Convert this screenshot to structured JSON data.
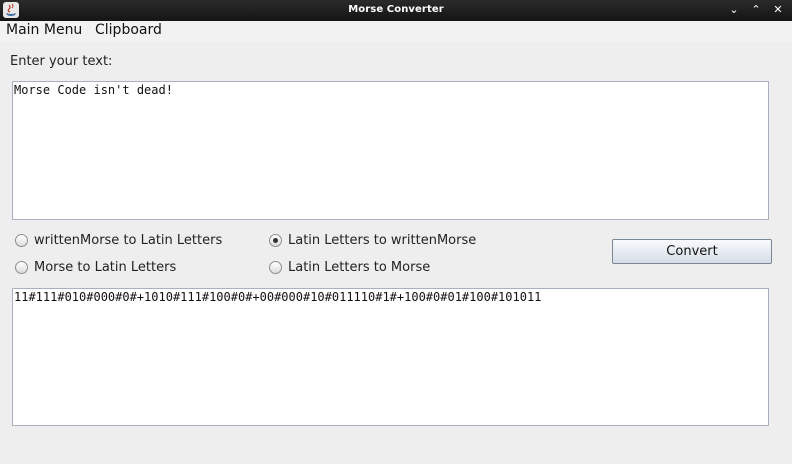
{
  "window": {
    "title": "Morse Converter",
    "controls": {
      "minimize": "⌄",
      "maximize": "⌃",
      "close": "✕"
    }
  },
  "menubar": {
    "items": [
      {
        "label": "Main Menu"
      },
      {
        "label": "Clipboard"
      }
    ]
  },
  "input": {
    "label": "Enter your text:",
    "value": "Morse Code isn't dead!"
  },
  "options": [
    {
      "label": "writtenMorse to Latin Letters",
      "checked": false
    },
    {
      "label": "Latin Letters to writtenMorse",
      "checked": true
    },
    {
      "label": "Morse to Latin Letters",
      "checked": false
    },
    {
      "label": "Latin Letters to Morse",
      "checked": false
    }
  ],
  "convert_button": {
    "label": "Convert"
  },
  "output": {
    "value": "11#111#010#000#0#+1010#111#100#0#+00#000#10#011110#1#+100#0#01#100#101011"
  }
}
